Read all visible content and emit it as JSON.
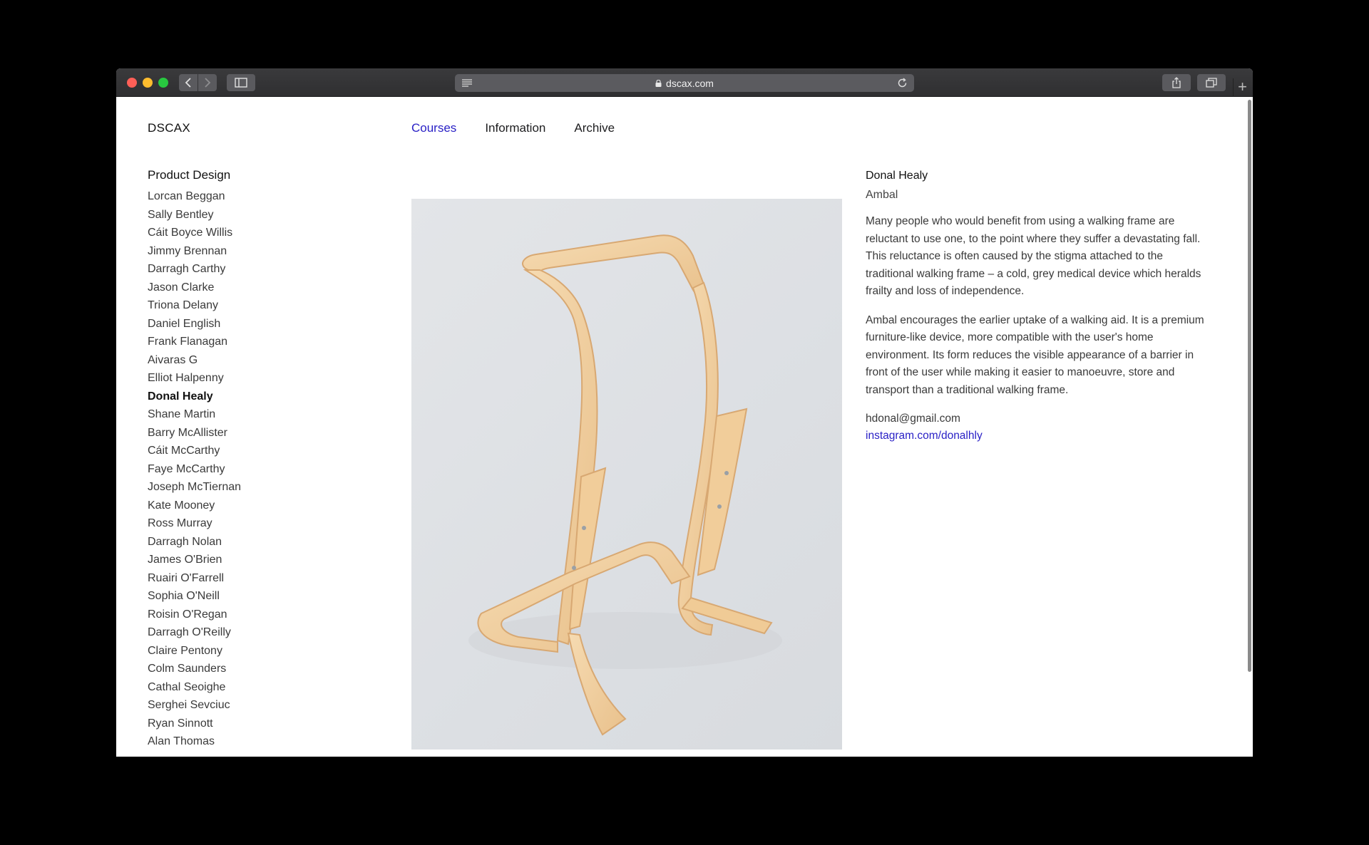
{
  "browser": {
    "url": "dscax.com"
  },
  "site": {
    "logo": "DSCAX",
    "nav": [
      {
        "label": "Courses"
      },
      {
        "label": "Information"
      },
      {
        "label": "Archive"
      }
    ]
  },
  "sidebar": {
    "section_title": "Product Design",
    "students": [
      "Lorcan Beggan",
      "Sally Bentley",
      "Cáit Boyce Willis",
      "Jimmy Brennan",
      "Darragh Carthy",
      "Jason Clarke",
      "Triona Delany",
      "Daniel English",
      "Frank Flanagan",
      "Aivaras G",
      "Elliot Halpenny",
      "Donal Healy",
      "Shane Martin",
      "Barry McAllister",
      "Cáit McCarthy",
      "Faye McCarthy",
      "Joseph McTiernan",
      "Kate Mooney",
      "Ross Murray",
      "Darragh Nolan",
      "James O'Brien",
      "Ruairi O'Farrell",
      "Sophia O'Neill",
      "Roisin O'Regan",
      "Darragh O'Reilly",
      "Claire Pentony",
      "Colm Saunders",
      "Cathal Seoighe",
      "Serghei Sevciuc",
      "Ryan Sinnott",
      "Alan Thomas"
    ],
    "current": "Donal Healy"
  },
  "project": {
    "student_name": "Donal Healy",
    "title": "Ambal",
    "paragraphs": [
      "Many people who would benefit from using a walking frame are reluctant to use one, to the point where they suffer a devastating fall. This reluctance is often caused by the stigma attached to the traditional walking frame – a cold, grey medical device which heralds frailty and loss of independence.",
      "Ambal encourages the earlier uptake of a walking aid. It is a premium furniture-like device, more compatible with the user's home environment. Its form reduces the visible appearance of a barrier in front of the user while making it easier to manoeuvre, store and transport than a traditional walking frame."
    ],
    "email": "hdonal@gmail.com",
    "instagram": "instagram.com/donalhly"
  },
  "colors": {
    "accent": "#2a21c6",
    "wood": "#f0cfa0"
  }
}
